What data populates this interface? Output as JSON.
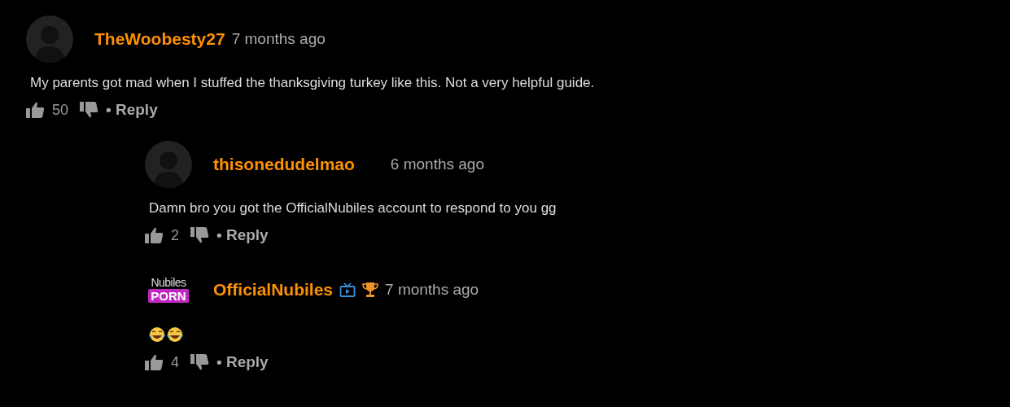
{
  "comments": [
    {
      "author": "TheWoobesty27",
      "time": "7 months ago",
      "avatar": {
        "kind": "silhouette"
      },
      "body": "My parents got mad when I stuffed the thanksgiving turkey like this. Not a very helpful guide.",
      "likes": "50",
      "reply": "• Reply",
      "replies": [
        {
          "author": "thisonedudelmao",
          "time": "6 months ago",
          "avatar": {
            "kind": "silhouette"
          },
          "body": "Damn bro you got the OfficialNubiles account to respond to you gg",
          "likes": "2",
          "reply": "• Reply"
        },
        {
          "author": "OfficialNubiles",
          "time": "7 months ago",
          "avatar": {
            "kind": "logo",
            "line_1": "Nubiles",
            "line_2": "PORN"
          },
          "badges": [
            {
              "kind": "channel"
            },
            {
              "kind": "trophy"
            }
          ],
          "emoji": [
            {
              "kind": "tears-of-joy"
            },
            {
              "kind": "tears-of-joy"
            }
          ],
          "likes": "4",
          "reply": "• Reply"
        }
      ]
    }
  ]
}
